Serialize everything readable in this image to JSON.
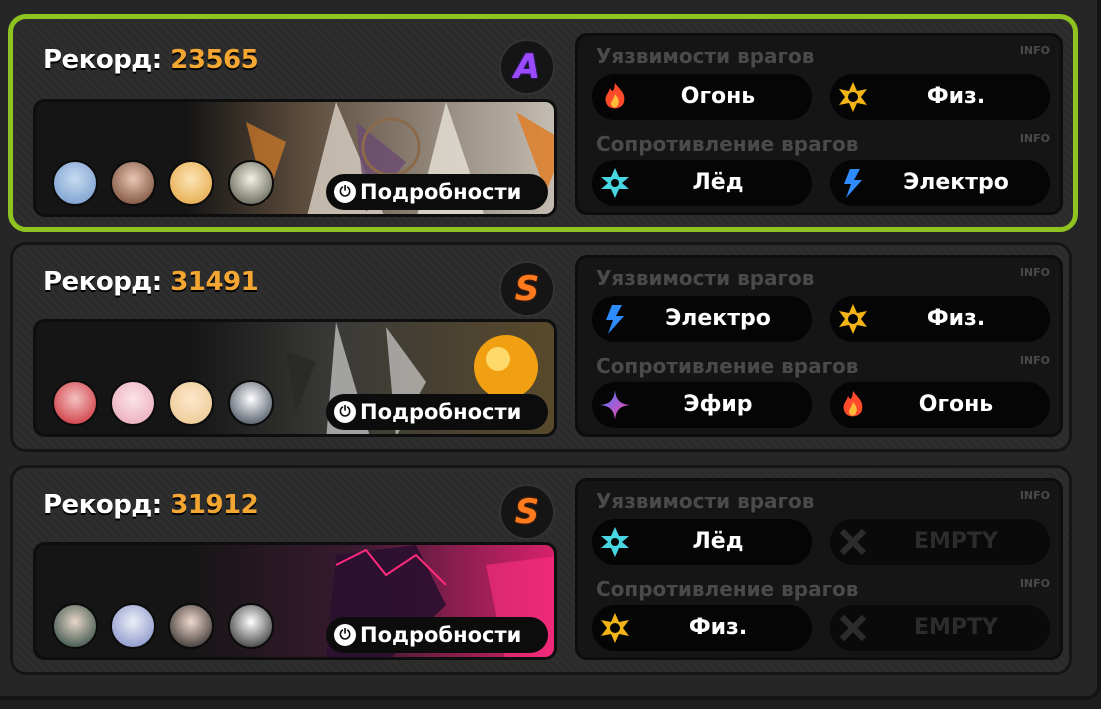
{
  "labels": {
    "record": "Рекорд:",
    "weakness_title": "Уязвимости врагов",
    "resist_title": "Сопротивление врагов",
    "info": "INFO",
    "details": "Подробности"
  },
  "colors": {
    "accent_active": "#8fc31f",
    "record_value": "#f4a633",
    "rank_a": "#9b4bff",
    "rank_s": "#ff7b1e"
  },
  "cards": [
    {
      "record": "23565",
      "rank": "A",
      "selected": true,
      "team_icons": [
        "character-avatar-blue-hair",
        "character-avatar-brown-hair",
        "character-avatar-blonde",
        "character-avatar-robot"
      ],
      "weaknesses": [
        {
          "label": "Огонь",
          "icon": "fire-icon"
        },
        {
          "label": "Физ.",
          "icon": "physical-icon"
        }
      ],
      "resistances": [
        {
          "label": "Лёд",
          "icon": "ice-icon"
        },
        {
          "label": "Электро",
          "icon": "electric-icon"
        }
      ]
    },
    {
      "record": "31491",
      "rank": "S",
      "selected": false,
      "team_icons": [
        "character-avatar-red-hair",
        "character-avatar-pink-hair",
        "character-avatar-blonde",
        "character-avatar-mascot"
      ],
      "weaknesses": [
        {
          "label": "Электро",
          "icon": "electric-icon"
        },
        {
          "label": "Физ.",
          "icon": "physical-icon"
        }
      ],
      "resistances": [
        {
          "label": "Эфир",
          "icon": "ether-icon"
        },
        {
          "label": "Огонь",
          "icon": "fire-icon"
        }
      ]
    },
    {
      "record": "31912",
      "rank": "S",
      "selected": false,
      "team_icons": [
        "character-avatar-dark-hair",
        "character-avatar-silver-hair",
        "character-avatar-black-hair",
        "character-avatar-mascot"
      ],
      "weaknesses": [
        {
          "label": "Лёд",
          "icon": "ice-icon"
        },
        {
          "label": "EMPTY",
          "icon": "empty-x-icon"
        }
      ],
      "resistances": [
        {
          "label": "Физ.",
          "icon": "physical-icon"
        },
        {
          "label": "EMPTY",
          "icon": "empty-x-icon"
        }
      ]
    }
  ]
}
